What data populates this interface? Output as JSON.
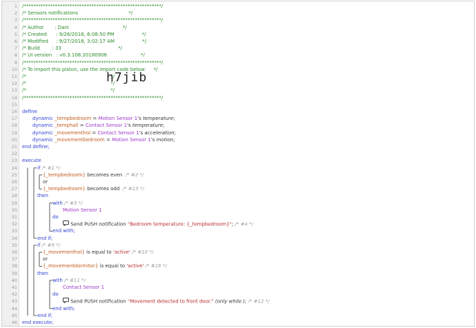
{
  "header": [
    "/*********************************************************/",
    "/* Sensors notifications                                 */",
    "/*********************************************************/",
    "/* Author       : Dani                                   */",
    "/* Created      : 9/26/2018, 6:08:50 PM                  */",
    "/* Modified     : 9/27/2018, 3:02:17 AM                  */",
    "/* Build        : 33                                     */",
    "/* UI version   : v0.3.108.20180906                      */",
    "/*********************************************************/",
    "/* To import this piston, use the import code below:     */",
    "/*                                                       */",
    "/*                                                       */",
    "/*                                                       */",
    "/*********************************************************/"
  ],
  "import_code": "h7jib",
  "define": {
    "start": "define",
    "end": "end define;",
    "vars": [
      {
        "type": "dynamic",
        "name": "_tempbedroom",
        "device": "Motion Sensor 1",
        "attr": "temperature"
      },
      {
        "type": "dynamic",
        "name": "_temphall",
        "device": "Contact Sensor 1",
        "attr": "temperature"
      },
      {
        "type": "dynamic",
        "name": "_movementhol",
        "device": "Contact Sensor 1",
        "attr": "acceleration"
      },
      {
        "type": "dynamic",
        "name": "_movementbedroom",
        "device": "Motion Sensor 1",
        "attr": "motion"
      }
    ]
  },
  "execute": {
    "start": "execute",
    "end": "end execute;",
    "blocks": [
      {
        "if_kw": "if",
        "if_comment": "/* #1 */",
        "cond1_var": "{_tempbedroom}",
        "cond1_op": " becomes even ",
        "cond1_comment": "/* #2 */",
        "or": "or",
        "cond2_var": "{_tempbedroom}",
        "cond2_op": " becomes odd ",
        "cond2_comment": "/* #13 */",
        "then": "then",
        "with": "with",
        "with_comment": "/* #3 */",
        "device": "Motion Sensor 1",
        "do": "do",
        "task": "Send PUSH notification ",
        "task_str": "\"Bedroom temperature: {_tempbedroom}\"",
        "task_tail": ";",
        "task_only": "",
        "task_comment": "/* #4 */",
        "end_with": "end with;",
        "end_if": "end if;"
      },
      {
        "if_kw": "if",
        "if_comment": "/* #9 */",
        "cond1_var": "{_movementhol}",
        "cond1_op": " is equal to ",
        "cond1_val": "'active'",
        "cond1_comment": "/* #10 */",
        "or": "or",
        "cond2_var": "{_movementdormitor}",
        "cond2_op": " is equal to ",
        "cond2_val": "'active'",
        "cond2_comment": "/* #16 */",
        "then": "then",
        "with": "with",
        "with_comment": "/* #11 */",
        "device": "Contact Sensor 1",
        "do": "do",
        "task": "Send PUSH notification ",
        "task_str": "\"Movement detected to front door.\"",
        "task_tail": "",
        "task_only": "(only while );",
        "task_comment": "/* #12 */",
        "end_with": "end with;",
        "end_if": "end if;"
      }
    ]
  },
  "line_numbers": [
    "1",
    "2",
    "3",
    "4",
    "5",
    "6",
    "7",
    "8",
    "9",
    "10",
    "11",
    "12",
    "13",
    "14",
    "15",
    "16",
    "17",
    "18",
    "19",
    "20",
    "21",
    "22",
    "23",
    "24",
    "25",
    "26",
    "27",
    "28",
    "29",
    "30",
    "31",
    "32",
    "33",
    "34",
    "35",
    "36",
    "37",
    "38",
    "39",
    "40",
    "41",
    "42",
    "43",
    "44",
    "45",
    "46"
  ],
  "icons": {
    "task": "chat-bubble-icon"
  },
  "colors": {
    "comment": "#2a8a2a",
    "keyword": "#2f3fd0",
    "variable": "#c05a1c",
    "device": "#9b35c9",
    "string": "#b8282a"
  }
}
